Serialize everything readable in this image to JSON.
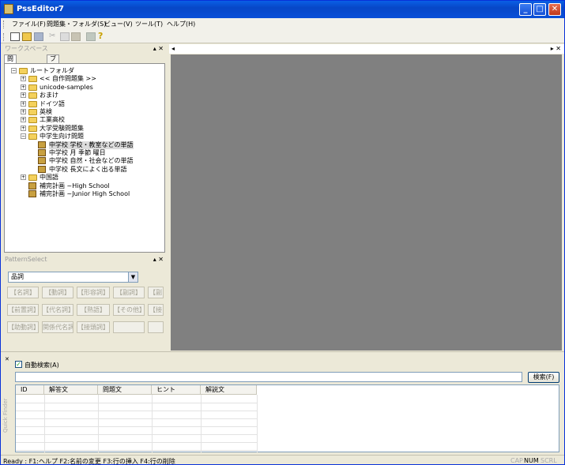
{
  "window": {
    "title": "PssEditor7"
  },
  "menubar": [
    "ファイル(F)",
    "問題集・フォルダ(S)",
    "ビュー(V)",
    "ツール(T)",
    "ヘルプ(H)"
  ],
  "workspace": {
    "title": "ワークスペース",
    "tabs": [
      "問題集ツリー",
      "ブラウザ"
    ],
    "tree": [
      {
        "label": "ルートフォルダ",
        "level": 0,
        "exp": "−",
        "icon": "folder"
      },
      {
        "label": "<< 自作問題集 >>",
        "level": 1,
        "exp": "+",
        "icon": "folder"
      },
      {
        "label": "unicode-samples",
        "level": 1,
        "exp": "+",
        "icon": "folder"
      },
      {
        "label": "おまけ",
        "level": 1,
        "exp": "+",
        "icon": "folder"
      },
      {
        "label": "ドイツ語",
        "level": 1,
        "exp": "+",
        "icon": "folder"
      },
      {
        "label": "英検",
        "level": 1,
        "exp": "+",
        "icon": "folder"
      },
      {
        "label": "工業高校",
        "level": 1,
        "exp": "+",
        "icon": "folder"
      },
      {
        "label": "大学受験問題集",
        "level": 1,
        "exp": "+",
        "icon": "folder"
      },
      {
        "label": "中学生向け問題",
        "level": 1,
        "exp": "−",
        "icon": "folder"
      },
      {
        "label": "中学校 学校・教室などの単語",
        "level": 2,
        "exp": "",
        "icon": "book",
        "selected": true
      },
      {
        "label": "中学校 月 季節 曜日",
        "level": 2,
        "exp": "",
        "icon": "book"
      },
      {
        "label": "中学校 自然・社会などの単語",
        "level": 2,
        "exp": "",
        "icon": "book"
      },
      {
        "label": "中学校 長文によく出る単語",
        "level": 2,
        "exp": "",
        "icon": "book"
      },
      {
        "label": "中国語",
        "level": 1,
        "exp": "+",
        "icon": "folder"
      },
      {
        "label": "補完計画 ~High School",
        "level": 1,
        "exp": "",
        "icon": "book"
      },
      {
        "label": "補完計画 ~Junior High School",
        "level": 1,
        "exp": "",
        "icon": "book"
      }
    ]
  },
  "pattern_select": {
    "title": "PatternSelect",
    "combo_value": "品詞",
    "buttons": [
      [
        "【名詞】",
        "【動詞】",
        "【形容詞】",
        "【副詞】",
        "【副"
      ],
      [
        "【前置詞】",
        "【代名詞】",
        "【熟語】",
        "【その他】",
        "【接"
      ],
      [
        "【助動詞】",
        "関係代名詞",
        "【接頭詞】",
        "",
        ""
      ]
    ]
  },
  "quick_finder": {
    "label": "Quick Finder",
    "auto_search_label": "自動検索(A)",
    "auto_search_checked": true,
    "search_value": "",
    "search_button": "検索(F)",
    "columns": [
      "ID",
      "解答文",
      "問題文",
      "ヒント",
      "解説文"
    ]
  },
  "status": {
    "text": "Ready :  F1:ヘルプ  F2:名前の変更  F3:行の挿入  F4:行の削除",
    "caps": "CAP",
    "num": "NUM",
    "scrl": "SCRL"
  }
}
